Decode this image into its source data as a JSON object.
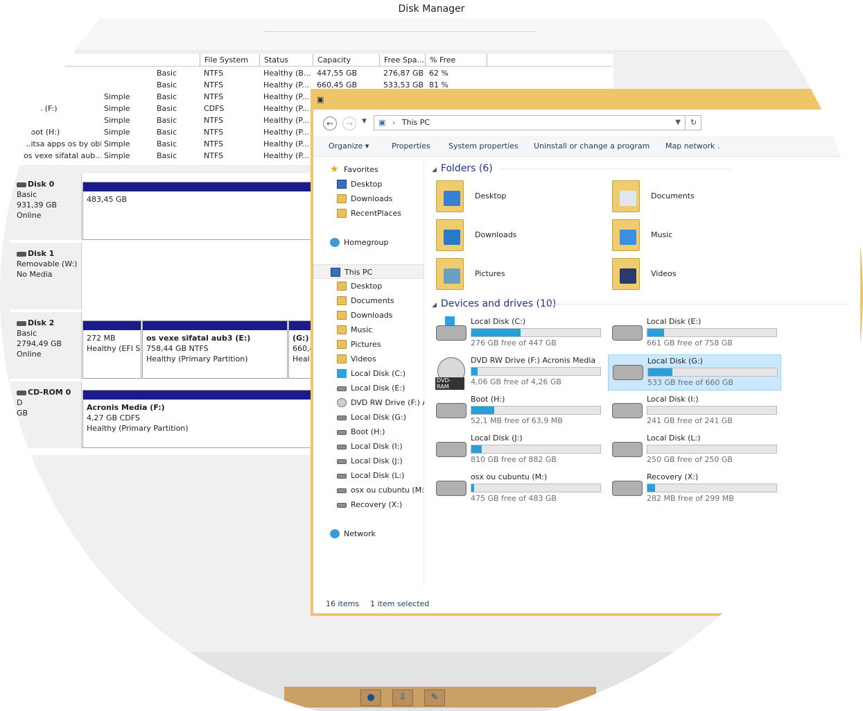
{
  "disk_management": {
    "title": "Disk Manager",
    "columns": [
      "File System",
      "Status",
      "Capacity",
      "Free Spa...",
      "% Free"
    ],
    "volumes": [
      {
        "name": "",
        "layout": "",
        "type": "Basic",
        "fs": "NTFS",
        "status": "Healthy (B...",
        "capacity": "447,55 GB",
        "free": "276,87 GB",
        "pct": "62 %"
      },
      {
        "name": "",
        "layout": "",
        "type": "Basic",
        "fs": "NTFS",
        "status": "Healthy (P...",
        "capacity": "660,45 GB",
        "free": "533,53 GB",
        "pct": "81 %"
      },
      {
        "name": "",
        "layout": "Simple",
        "type": "Basic",
        "fs": "NTFS",
        "status": "Healthy (P...",
        "capacity": "",
        "free": "",
        "pct": ""
      },
      {
        "name": "...dia (F:)",
        "layout": "Simple",
        "type": "Basic",
        "fs": "CDFS",
        "status": "Healthy (P...",
        "capacity": "",
        "free": "",
        "pct": ""
      },
      {
        "name": "...:)",
        "layout": "Simple",
        "type": "Basic",
        "fs": "NTFS",
        "status": "Healthy (P...",
        "capacity": "",
        "free": "",
        "pct": ""
      },
      {
        "name": "...oot (H:)",
        "layout": "Simple",
        "type": "Basic",
        "fs": "NTFS",
        "status": "Healthy (P...",
        "capacity": "",
        "free": "",
        "pct": ""
      },
      {
        "name": "...itsa apps os by obl...",
        "layout": "Simple",
        "type": "Basic",
        "fs": "NTFS",
        "status": "Healthy (P...",
        "capacity": "",
        "free": "",
        "pct": ""
      },
      {
        "name": "os vexe sifatal aub...",
        "layout": "Simple",
        "type": "Basic",
        "fs": "NTFS",
        "status": "Healthy (P...",
        "capacity": "",
        "free": "",
        "pct": ""
      }
    ],
    "disks": [
      {
        "name": "Disk 0",
        "line1": "Basic",
        "line2": "931,39 GB",
        "line3": "Online",
        "parts": [
          {
            "title": "",
            "l1": "483,45 GB",
            "l2": ""
          }
        ]
      },
      {
        "name": "Disk 1",
        "line1": "Removable (W:)",
        "line2": "",
        "line3": "No Media",
        "parts": []
      },
      {
        "name": "Disk 2",
        "line1": "Basic",
        "line2": "2794,49 GB",
        "line3": "Online",
        "parts": [
          {
            "title": "",
            "l1": "272 MB",
            "l2": "Healthy (EFI S"
          },
          {
            "title": "os vexe sifatal aub3  (E:)",
            "l1": "758,44 GB NTFS",
            "l2": "Healthy (Primary Partition)"
          },
          {
            "title": "(G:)",
            "l1": "660,4",
            "l2": "Heal"
          }
        ]
      },
      {
        "name": "CD-ROM 0",
        "line1": "D",
        "line2": "GB",
        "line3": "",
        "parts": [
          {
            "title": "Acronis Media  (F:)",
            "l1": "4,27 GB CDFS",
            "l2": "Healthy (Primary Partition)"
          }
        ]
      }
    ]
  },
  "explorer": {
    "address": "This PC",
    "commands": [
      "Organize ▾",
      "Properties",
      "System properties",
      "Uninstall or change a program",
      "Map network ."
    ],
    "nav": {
      "favorites": "Favorites",
      "fav_items": [
        "Desktop",
        "Downloads",
        "RecentPlaces"
      ],
      "homegroup": "Homegroup",
      "this_pc": "This PC",
      "pc_items": [
        "Desktop",
        "Documents",
        "Downloads",
        "Music",
        "Pictures",
        "Videos",
        "Local Disk (C:)",
        "Local Disk (E:)",
        "DVD RW Drive (F:) A",
        "Local Disk (G:)",
        "Boot (H:)",
        "Local Disk (I:)",
        "Local Disk (J:)",
        "Local Disk (L:)",
        "osx ou cubuntu (M:)",
        "Recovery (X:)"
      ],
      "network": "Network"
    },
    "folders_header": "Folders (6)",
    "folders": [
      "Desktop",
      "Documents",
      "Downloads",
      "Music",
      "Pictures",
      "Videos"
    ],
    "drives_header": "Devices and drives (10)",
    "drives": [
      {
        "name": "Local Disk (C:)",
        "free": "276 GB free of 447 GB",
        "used": 0.38,
        "kind": "win"
      },
      {
        "name": "Local Disk (E:)",
        "free": "661 GB free of 758 GB",
        "used": 0.13,
        "kind": "hdd"
      },
      {
        "name": "DVD RW Drive (F:) Acronis Media",
        "free": "4,06 GB free of 4,26 GB",
        "used": 0.05,
        "kind": "cd"
      },
      {
        "name": "Local Disk (G:)",
        "free": "533 GB free of 660 GB",
        "used": 0.19,
        "kind": "hdd",
        "selected": true
      },
      {
        "name": "Boot (H:)",
        "free": "52,1 MB free of 63,9 MB",
        "used": 0.18,
        "kind": "hdd"
      },
      {
        "name": "Local Disk (I:)",
        "free": "241 GB free of 241 GB",
        "used": 0.0,
        "kind": "hdd"
      },
      {
        "name": "Local Disk (J:)",
        "free": "810 GB free of 882 GB",
        "used": 0.08,
        "kind": "hdd"
      },
      {
        "name": "Local Disk (L:)",
        "free": "250 GB free of 250 GB",
        "used": 0.0,
        "kind": "hdd"
      },
      {
        "name": "osx ou cubuntu (M:)",
        "free": "475 GB free of 483 GB",
        "used": 0.02,
        "kind": "hdd"
      },
      {
        "name": "Recovery (X:)",
        "free": "282 MB free of 299 MB",
        "used": 0.06,
        "kind": "hdd"
      }
    ],
    "status_items": "16 items",
    "status_selected": "1 item selected"
  },
  "colors": {
    "explorer_frame": "#f0c468",
    "accent_text": "#1e3287",
    "bar_fill": "#26a0da",
    "partition_header": "#1b1b8c",
    "selection": "#cce8ff"
  }
}
